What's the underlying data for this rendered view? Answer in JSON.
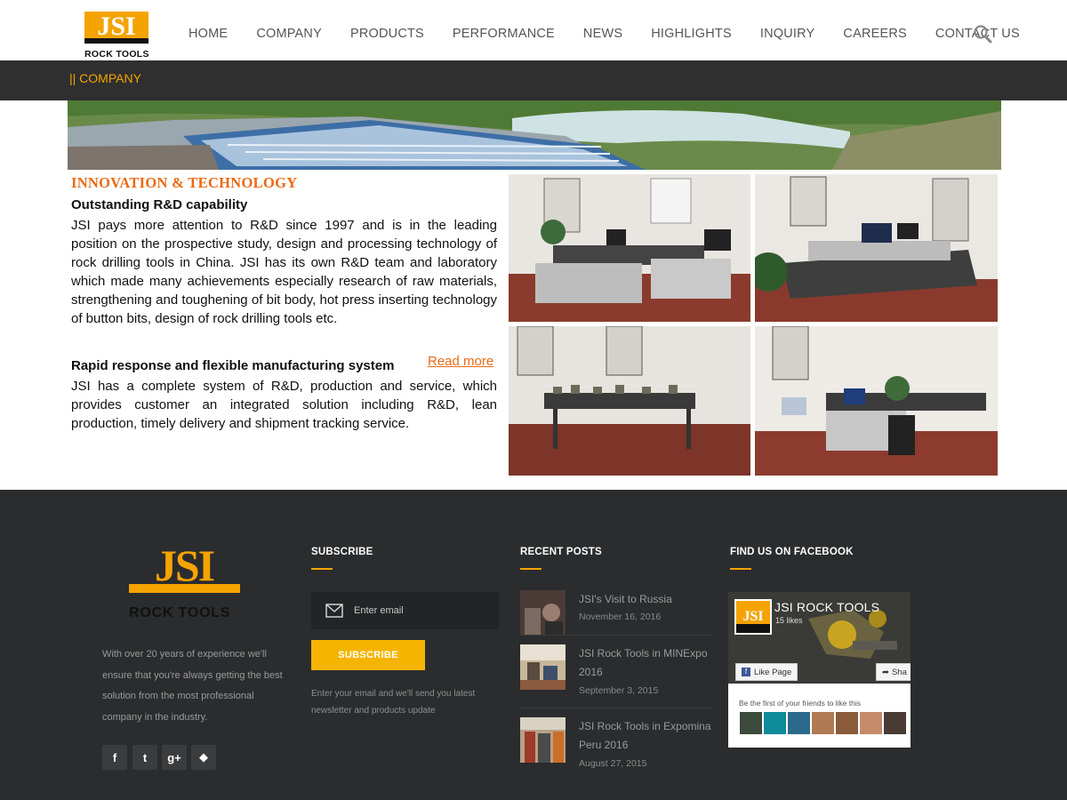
{
  "brand": {
    "logo_text": "JSI",
    "logo_caption": "ROCK TOOLS"
  },
  "nav": {
    "items": [
      "HOME",
      "COMPANY",
      "PRODUCTS",
      "PERFORMANCE",
      "NEWS",
      "HIGHLIGHTS",
      "INQUIRY",
      "CAREERS",
      "CONTACT US"
    ],
    "search_icon": "search-icon"
  },
  "breadcrumb": "|| COMPANY",
  "content": {
    "section_title": "INNOVATION & TECHNOLOGY",
    "block1": {
      "title": "Outstanding R&D capability",
      "text": "JSI pays more attention to R&D since 1997 and is in the leading position on the prospective study, design and processing technology of rock drilling tools in China. JSI has its own R&D team and laboratory which made many achievements especially research of raw materials, strengthening and toughening of bit body, hot press inserting technology of button bits, design of rock drilling tools etc."
    },
    "block2": {
      "title": "Rapid response and flexible manufacturing system",
      "text": "JSI has a complete system of R&D, production and service, which provides customer an integrated solution including R&D, lean production, timely delivery and shipment tracking service."
    },
    "read_more": "Read more"
  },
  "footer": {
    "about": "With over 20 years of experience we'll ensure that you're always getting the best solution from the most professional company in the industry.",
    "social": [
      {
        "name": "facebook",
        "glyph": "f"
      },
      {
        "name": "twitter",
        "glyph": "t"
      },
      {
        "name": "google-plus",
        "glyph": "g+"
      },
      {
        "name": "apple",
        "glyph": "◆"
      }
    ],
    "subscribe": {
      "heading": "SUBSCRIBE",
      "placeholder": "Enter email",
      "button": "SUBSCRIBE",
      "note": "Enter your email and we'll send you latest newsletter and products update"
    },
    "recent_posts": {
      "heading": "RECENT POSTS",
      "posts": [
        {
          "title": "JSI's Visit to Russia",
          "date": "November 16, 2016"
        },
        {
          "title": "JSI Rock Tools in MINExpo 2016",
          "date": "September 3, 2015"
        },
        {
          "title": "JSI Rock Tools in Expomina Peru 2016",
          "date": "August 27, 2015"
        }
      ]
    },
    "facebook": {
      "heading": "FIND US ON FACEBOOK",
      "page_name": "JSI ROCK TOOLS",
      "likes": "15 likes",
      "like_button": "Like Page",
      "share_button": "Sha",
      "friends_text": "Be the first of your friends to like this"
    }
  },
  "colors": {
    "accent_orange": "#e96a14",
    "brand_yellow": "#f5a300",
    "dark_bar": "#2f2f2f",
    "footer_bg": "#2a2c2e"
  }
}
